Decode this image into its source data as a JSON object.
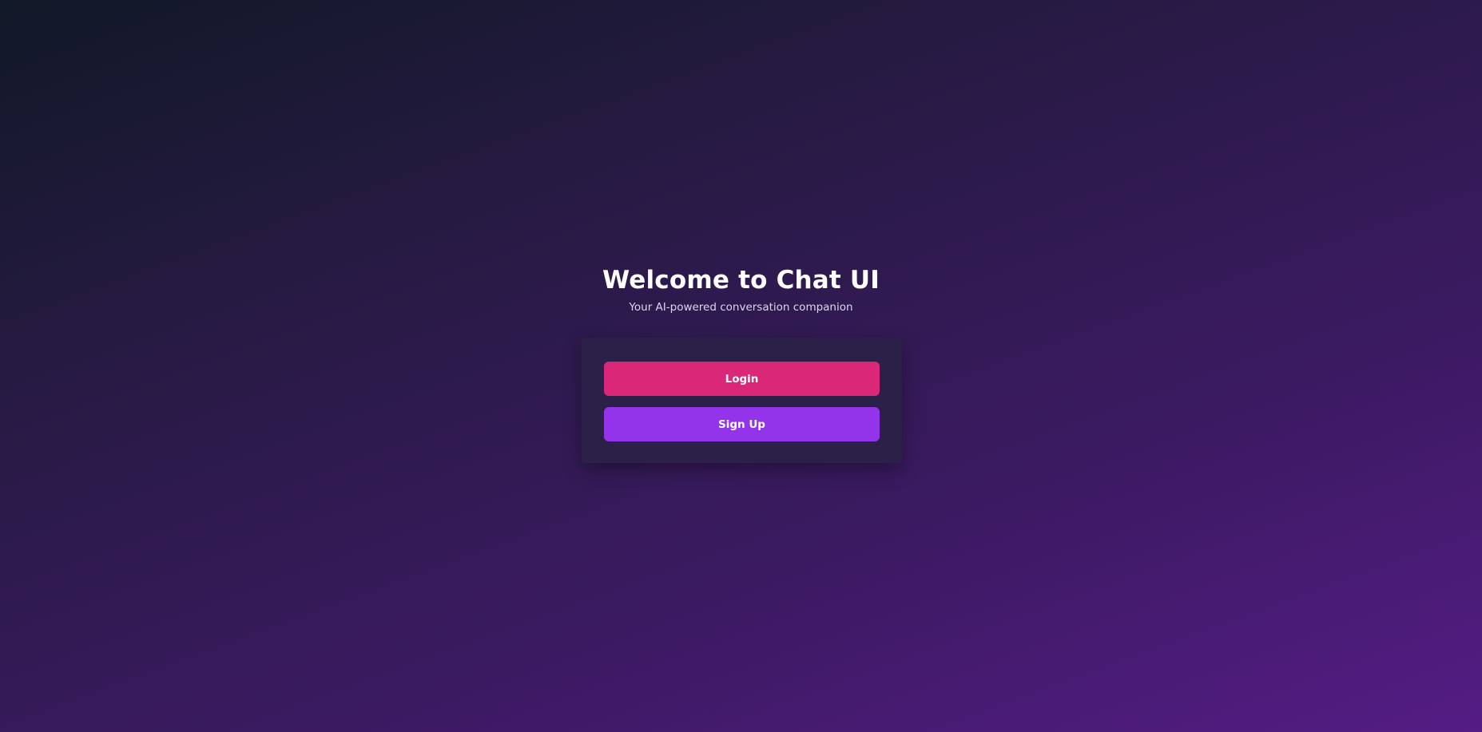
{
  "welcome": {
    "title": "Welcome to Chat UI",
    "subtitle": "Your AI-powered conversation companion"
  },
  "auth": {
    "login_label": "Login",
    "signup_label": "Sign Up"
  },
  "colors": {
    "login_button": "#db2777",
    "signup_button": "#9333ea",
    "card_background": "#2b2047",
    "background_start": "#111827",
    "background_end": "#541c84"
  }
}
